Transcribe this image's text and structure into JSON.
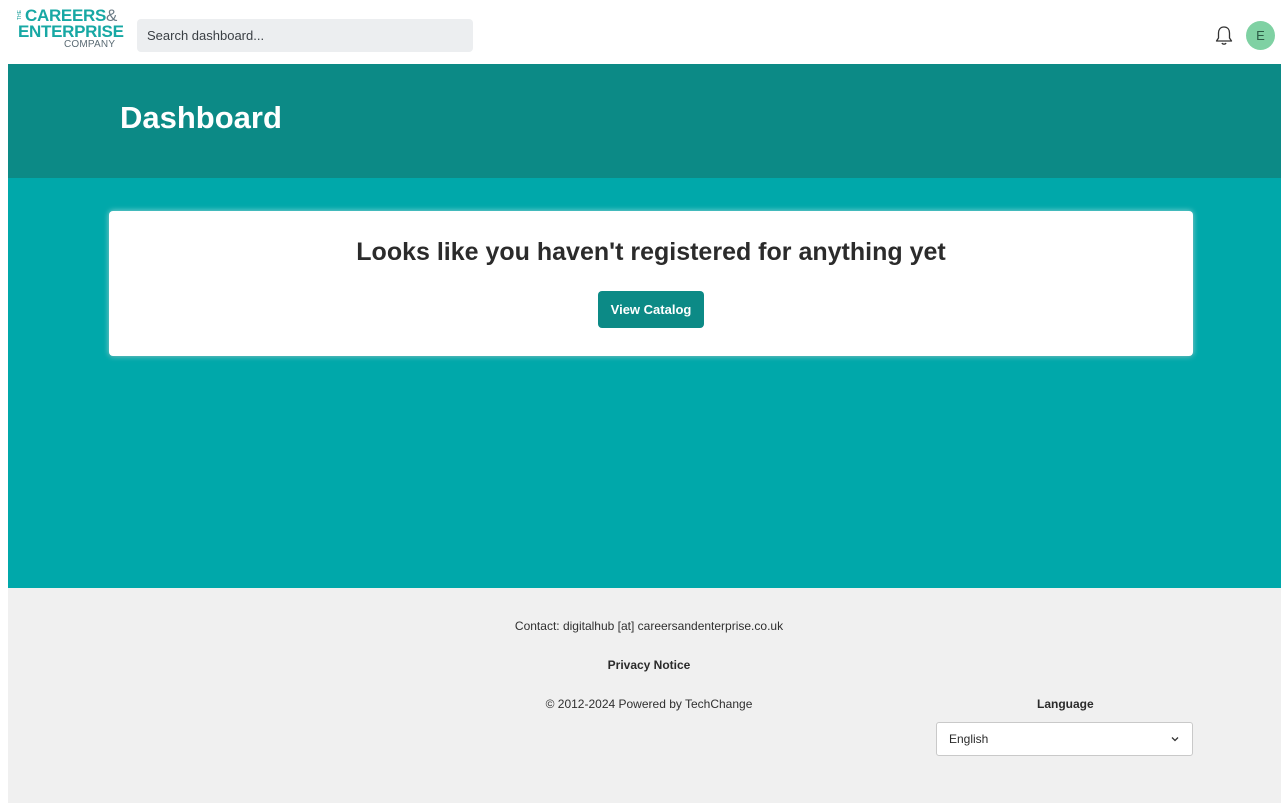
{
  "logo": {
    "the": "THE",
    "line1": "CAREERS",
    "amp": "&",
    "line2": "ENTERPRISE",
    "line3": "COMPANY"
  },
  "search": {
    "placeholder": "Search dashboard..."
  },
  "header": {
    "notification_icon": "bell-icon",
    "avatar_initial": "E"
  },
  "page": {
    "title": "Dashboard"
  },
  "empty_state": {
    "message": "Looks like you haven't registered for anything yet",
    "button_label": "View Catalog"
  },
  "footer": {
    "contact": "Contact:  digitalhub [at] careersandenterprise.co.uk",
    "privacy": "Privacy Notice",
    "copyright": "© 2012-2024  Powered by TechChange",
    "language_label": "Language",
    "language_value": "English"
  },
  "colors": {
    "header_band": "#0c8a86",
    "main_bg": "#00a8aa",
    "button": "#0c8a86",
    "avatar": "#7fd1a3",
    "footer_bg": "#f0f0f0"
  }
}
